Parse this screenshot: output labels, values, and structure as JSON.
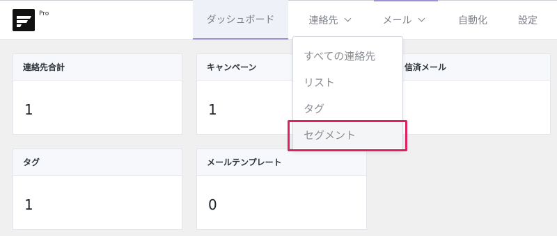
{
  "app": {
    "logo_label": "Pro"
  },
  "nav": {
    "items": [
      {
        "label": "ダッシュボード",
        "active": true
      },
      {
        "label": "連絡先",
        "has_dropdown": true
      },
      {
        "label": "メール",
        "has_dropdown": true
      },
      {
        "label": "自動化"
      },
      {
        "label": "設定"
      }
    ]
  },
  "dropdown": {
    "items": [
      {
        "label": "すべての連絡先"
      },
      {
        "label": "リスト"
      },
      {
        "label": "タグ"
      },
      {
        "label": "セグメント",
        "highlighted": true
      }
    ]
  },
  "cards": [
    {
      "title": "連絡先合計",
      "value": "1"
    },
    {
      "title": "キャンペーン",
      "value": "1"
    },
    {
      "title": "信済メール",
      "value": ""
    },
    {
      "title": "タグ",
      "value": "1"
    },
    {
      "title": "メールテンプレート",
      "value": "0"
    }
  ],
  "colors": {
    "accent": "#9d8fd8",
    "highlight": "#e0205e"
  }
}
